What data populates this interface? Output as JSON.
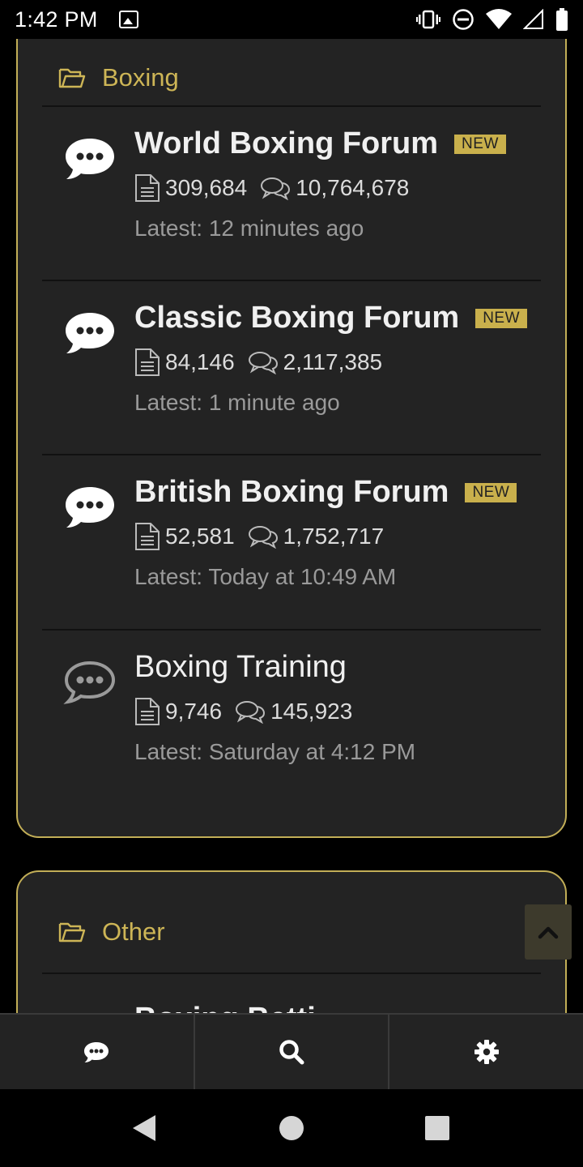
{
  "status_bar": {
    "time": "1:42 PM",
    "icons": [
      "image-icon",
      "vibrate-icon",
      "do-not-disturb-icon",
      "wifi-icon",
      "signal-icon",
      "battery-icon"
    ]
  },
  "categories": [
    {
      "title": "Boxing",
      "forums": [
        {
          "title": "World Boxing Forum",
          "badge": "NEW",
          "threads": "309,684",
          "messages": "10,764,678",
          "latest": "Latest: 12 minutes ago",
          "unread": true
        },
        {
          "title": "Classic Boxing Forum",
          "badge": "NEW",
          "threads": "84,146",
          "messages": "2,117,385",
          "latest": "Latest: 1 minute ago",
          "unread": true
        },
        {
          "title": "British Boxing Forum",
          "badge": "NEW",
          "threads": "52,581",
          "messages": "1,752,717",
          "latest": "Latest: Today at 10:49 AM",
          "unread": true
        },
        {
          "title": "Boxing Training",
          "badge": "",
          "threads": "9,746",
          "messages": "145,923",
          "latest": "Latest: Saturday at 4:12 PM",
          "unread": false
        }
      ]
    },
    {
      "title": "Other",
      "peek_forum_title": "Boxing Betti"
    }
  ],
  "colors": {
    "accent": "#c9b04c",
    "panel": "#232323",
    "background": "#000000"
  },
  "bottom_nav": [
    "chat-icon",
    "search-icon",
    "gear-icon"
  ],
  "android_nav": [
    "back-icon",
    "home-icon",
    "recents-icon"
  ]
}
